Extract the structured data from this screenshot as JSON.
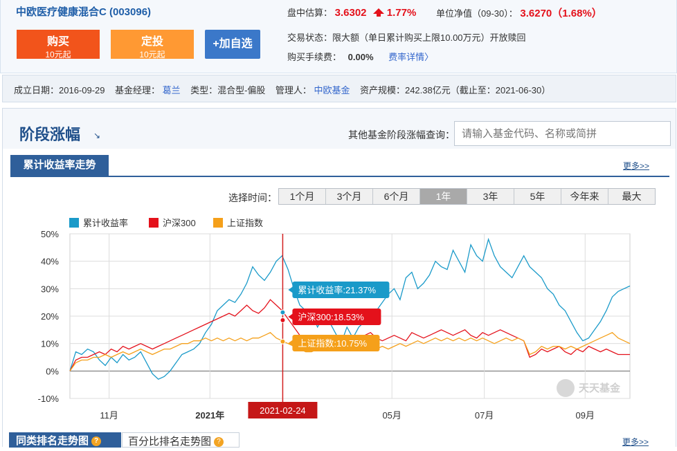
{
  "fund": {
    "title": "中欧医疗健康混合C (003096)",
    "est_label": "盘中估算：",
    "est_value": "3.6302",
    "est_change": "1.77%",
    "nav_label": "单位净值（09-30）：",
    "nav_value": "3.6270（1.68%）",
    "trade_status": "交易状态：限大额（单日累计购买上限10.00万元）开放赎回",
    "fee_label": "购买手续费：",
    "fee_value": "0.00%",
    "fee_link": "费率详情〉"
  },
  "buttons": {
    "buy": "购买",
    "buy_sub": "10元起",
    "auto": "定投",
    "auto_sub": "10元起",
    "fav": "+加自选"
  },
  "info": {
    "established": "成立日期：2016-09-29",
    "manager_label": "基金经理：",
    "manager": "葛兰",
    "type": "类型：混合型-偏股",
    "admin_label": "管理人：",
    "admin": "中欧基金",
    "scale": "资产规模：242.38亿元（截止至：2021-06-30）"
  },
  "section": {
    "title": "阶段涨幅",
    "title_arrow": "↘",
    "search_label": "其他基金阶段涨幅查询：",
    "search_placeholder": "请输入基金代码、名称或简拼",
    "tab": "累计收益率走势",
    "more": "更多>>",
    "time_label": "选择时间：",
    "time_options": [
      "1个月",
      "3个月",
      "6个月",
      "1年",
      "3年",
      "5年",
      "今年来",
      "最大"
    ],
    "active_option": "1年"
  },
  "bottom": {
    "tab1": "同类排名走势图",
    "tab2": "百分比排名走势图",
    "more": "更多>>"
  },
  "watermark": "天天基金",
  "chart_data": {
    "type": "line",
    "x_tick_labels": [
      "11月",
      "2021年",
      "05月",
      "07月",
      "09月"
    ],
    "y_tick_labels": [
      "50%",
      "40%",
      "30%",
      "20%",
      "10%",
      "0%",
      "-10%"
    ],
    "ylim": [
      -10,
      50
    ],
    "grid": true,
    "legend_position": "top-left",
    "crosshair_date": "2021-02-24",
    "tooltips": [
      "累计收益率:21.37%",
      "沪深300:18.53%",
      "上证指数:10.75%"
    ],
    "colors": {
      "fund": "#1a9ac9",
      "hs300": "#e4111b",
      "sh": "#f5a01a"
    },
    "series": [
      {
        "name": "累计收益率",
        "values": [
          0,
          7,
          6,
          8,
          7,
          4,
          2,
          5,
          3,
          6,
          4,
          5,
          7,
          3,
          -1,
          -3,
          -2,
          0,
          3,
          6,
          7,
          8,
          10,
          14,
          17,
          22,
          24,
          26,
          25,
          28,
          32,
          38,
          35,
          33,
          36,
          40,
          42,
          37,
          30,
          24,
          22,
          21,
          16,
          20,
          18,
          14,
          10,
          16,
          12,
          16,
          18,
          20,
          22,
          25,
          28,
          30,
          26,
          34,
          36,
          30,
          32,
          35,
          40,
          38,
          37,
          44,
          40,
          36,
          46,
          42,
          40,
          48,
          42,
          38,
          36,
          34,
          38,
          42,
          38,
          36,
          34,
          30,
          28,
          24,
          22,
          18,
          14,
          11,
          12,
          15,
          18,
          22,
          27,
          29,
          30,
          31
        ]
      },
      {
        "name": "沪深300",
        "values": [
          0,
          4,
          5,
          5,
          6,
          7,
          6,
          8,
          7,
          9,
          8,
          9,
          10,
          9,
          8,
          9,
          10,
          11,
          12,
          13,
          14,
          15,
          16,
          17,
          18,
          19,
          20,
          21,
          20,
          22,
          24,
          22,
          21,
          23,
          26,
          24,
          22,
          19,
          16,
          13,
          10,
          8,
          9,
          10,
          11,
          12,
          13,
          12,
          11,
          12,
          13,
          14,
          12,
          11,
          12,
          13,
          12,
          11,
          14,
          13,
          12,
          13,
          14,
          15,
          14,
          13,
          14,
          15,
          13,
          12,
          14,
          13,
          14,
          15,
          14,
          13,
          12,
          11,
          5,
          6,
          8,
          7,
          8,
          9,
          7,
          6,
          8,
          7,
          9,
          8,
          7,
          8,
          7,
          6,
          6,
          6
        ]
      },
      {
        "name": "上证指数",
        "values": [
          0,
          3,
          4,
          4,
          5,
          5,
          6,
          5,
          6,
          7,
          6,
          7,
          8,
          7,
          6,
          7,
          8,
          8,
          9,
          10,
          10,
          11,
          11,
          12,
          11,
          12,
          11,
          12,
          11,
          12,
          11,
          12,
          12,
          13,
          14,
          12,
          11,
          10,
          9,
          8,
          7,
          7,
          8,
          8,
          9,
          9,
          8,
          9,
          8,
          9,
          9,
          8,
          8,
          9,
          8,
          9,
          10,
          9,
          10,
          11,
          10,
          11,
          12,
          11,
          12,
          11,
          12,
          11,
          12,
          11,
          12,
          11,
          10,
          11,
          12,
          11,
          12,
          11,
          6,
          7,
          9,
          8,
          9,
          9,
          8,
          9,
          8,
          9,
          10,
          11,
          12,
          13,
          14,
          12,
          11,
          10
        ]
      }
    ]
  }
}
